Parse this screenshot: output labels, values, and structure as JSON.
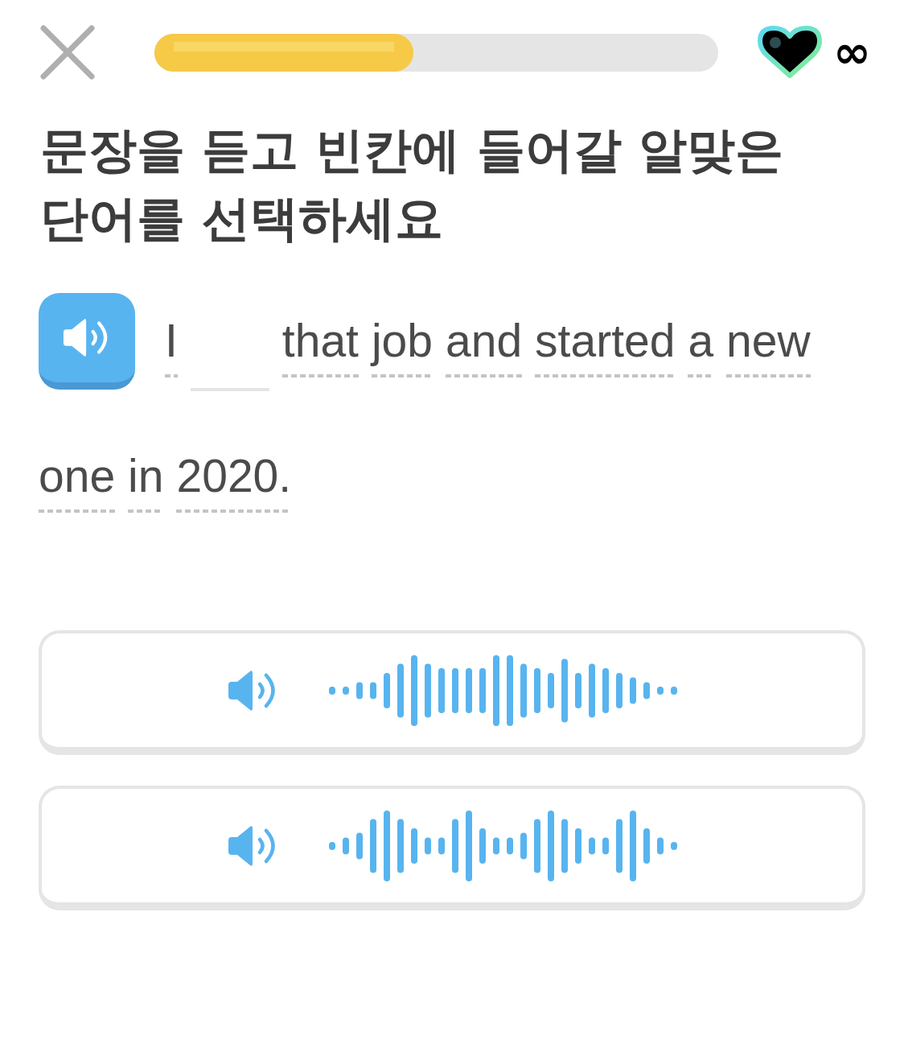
{
  "header": {
    "progress": {
      "level": 0.46
    },
    "hearts": {
      "count": "∞"
    }
  },
  "prompt": {
    "title": "문장을 듣고 빈칸에 들어갈 알맞은 단어를 선택하세요"
  },
  "sentence": {
    "tokens": [
      {
        "kind": "word",
        "text": "I"
      },
      {
        "kind": "blank"
      },
      {
        "kind": "word",
        "text": "that"
      },
      {
        "kind": "word",
        "text": "job"
      },
      {
        "kind": "word",
        "text": "and"
      },
      {
        "kind": "word",
        "text": "started"
      },
      {
        "kind": "word",
        "text": "a"
      },
      {
        "kind": "word",
        "text": "new"
      },
      {
        "kind": "word",
        "text": "one"
      },
      {
        "kind": "word",
        "text": "in"
      },
      {
        "kind": "word",
        "text": "2020."
      }
    ]
  },
  "options": [
    {
      "kind": "swell",
      "selected": false
    },
    {
      "kind": "pulse",
      "selected": false
    }
  ]
}
